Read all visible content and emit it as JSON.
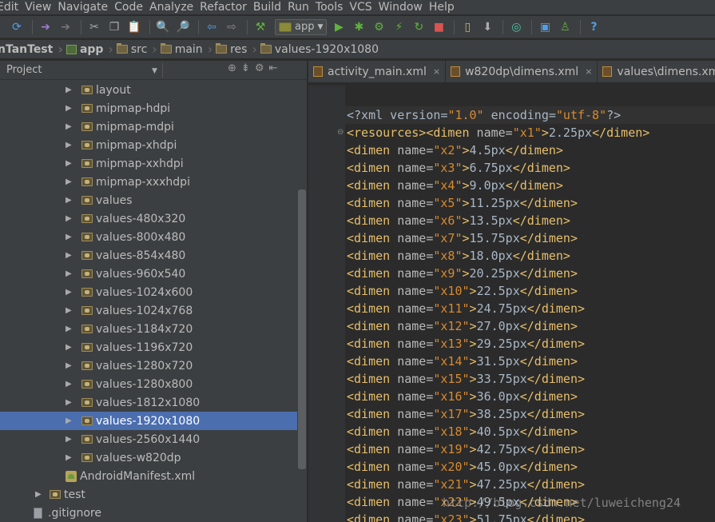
{
  "menu": [
    "Edit",
    "View",
    "Navigate",
    "Code",
    "Analyze",
    "Refactor",
    "Build",
    "Run",
    "Tools",
    "VCS",
    "Window",
    "Help"
  ],
  "toolbar": {
    "run_config": "app",
    "icons": [
      "sync-icon",
      "undo-icon",
      "redo-icon",
      "cut-icon",
      "copy-icon",
      "paste-icon",
      "find-icon",
      "replace-icon",
      "back-icon",
      "forward-icon",
      "make-icon",
      "run-icon",
      "debug-icon",
      "attach-icon",
      "apply-changes-icon",
      "rerun-icon",
      "stop-icon",
      "avd-manager-icon",
      "sdk-manager-icon",
      "project-structure-icon",
      "sync-gradle-icon",
      "help-icon"
    ]
  },
  "breadcrumb": [
    "nTanTest",
    "app",
    "src",
    "main",
    "res",
    "values-1920x1080"
  ],
  "project_panel": {
    "title": "Project",
    "items": [
      {
        "label": "layout",
        "type": "folder",
        "depth": 0,
        "expandable": true
      },
      {
        "label": "mipmap-hdpi",
        "type": "folder",
        "depth": 0,
        "expandable": true
      },
      {
        "label": "mipmap-mdpi",
        "type": "folder",
        "depth": 0,
        "expandable": true
      },
      {
        "label": "mipmap-xhdpi",
        "type": "folder",
        "depth": 0,
        "expandable": true
      },
      {
        "label": "mipmap-xxhdpi",
        "type": "folder",
        "depth": 0,
        "expandable": true
      },
      {
        "label": "mipmap-xxxhdpi",
        "type": "folder",
        "depth": 0,
        "expandable": true
      },
      {
        "label": "values",
        "type": "folder",
        "depth": 0,
        "expandable": true
      },
      {
        "label": "values-480x320",
        "type": "folder",
        "depth": 0,
        "expandable": true
      },
      {
        "label": "values-800x480",
        "type": "folder",
        "depth": 0,
        "expandable": true
      },
      {
        "label": "values-854x480",
        "type": "folder",
        "depth": 0,
        "expandable": true
      },
      {
        "label": "values-960x540",
        "type": "folder",
        "depth": 0,
        "expandable": true
      },
      {
        "label": "values-1024x600",
        "type": "folder",
        "depth": 0,
        "expandable": true
      },
      {
        "label": "values-1024x768",
        "type": "folder",
        "depth": 0,
        "expandable": true
      },
      {
        "label": "values-1184x720",
        "type": "folder",
        "depth": 0,
        "expandable": true
      },
      {
        "label": "values-1196x720",
        "type": "folder",
        "depth": 0,
        "expandable": true
      },
      {
        "label": "values-1280x720",
        "type": "folder",
        "depth": 0,
        "expandable": true
      },
      {
        "label": "values-1280x800",
        "type": "folder",
        "depth": 0,
        "expandable": true
      },
      {
        "label": "values-1812x1080",
        "type": "folder",
        "depth": 0,
        "expandable": true
      },
      {
        "label": "values-1920x1080",
        "type": "folder",
        "depth": 0,
        "expandable": true,
        "selected": true
      },
      {
        "label": "values-2560x1440",
        "type": "folder",
        "depth": 0,
        "expandable": true
      },
      {
        "label": "values-w820dp",
        "type": "folder",
        "depth": 0,
        "expandable": true
      },
      {
        "label": "AndroidManifest.xml",
        "type": "manifest",
        "depth": 1,
        "expandable": false
      },
      {
        "label": "test",
        "type": "folder",
        "depth": 2,
        "expandable": true
      },
      {
        "label": ".gitignore",
        "type": "file",
        "depth": 3,
        "expandable": false
      }
    ]
  },
  "tabs": [
    {
      "label": "activity_main.xml",
      "active": false
    },
    {
      "label": "w820dp\\dimens.xml",
      "active": false
    },
    {
      "label": "values\\dimens.xml",
      "active": false
    }
  ],
  "code": {
    "declaration": {
      "version": "1.0",
      "encoding": "utf-8"
    },
    "root_tag": "resources",
    "dimens": [
      {
        "name": "x1",
        "value": "2.25px"
      },
      {
        "name": "x2",
        "value": "4.5px"
      },
      {
        "name": "x3",
        "value": "6.75px"
      },
      {
        "name": "x4",
        "value": "9.0px"
      },
      {
        "name": "x5",
        "value": "11.25px"
      },
      {
        "name": "x6",
        "value": "13.5px"
      },
      {
        "name": "x7",
        "value": "15.75px"
      },
      {
        "name": "x8",
        "value": "18.0px"
      },
      {
        "name": "x9",
        "value": "20.25px"
      },
      {
        "name": "x10",
        "value": "22.5px"
      },
      {
        "name": "x11",
        "value": "24.75px"
      },
      {
        "name": "x12",
        "value": "27.0px"
      },
      {
        "name": "x13",
        "value": "29.25px"
      },
      {
        "name": "x14",
        "value": "31.5px"
      },
      {
        "name": "x15",
        "value": "33.75px"
      },
      {
        "name": "x16",
        "value": "36.0px"
      },
      {
        "name": "x17",
        "value": "38.25px"
      },
      {
        "name": "x18",
        "value": "40.5px"
      },
      {
        "name": "x19",
        "value": "42.75px"
      },
      {
        "name": "x20",
        "value": "45.0px"
      },
      {
        "name": "x21",
        "value": "47.25px"
      },
      {
        "name": "x22",
        "value": "49.5px"
      },
      {
        "name": "x23",
        "value": "51.75px"
      }
    ]
  },
  "watermark": "http://blog.csdn.net/luweicheng24",
  "colors": {
    "selection": "#4b6eaf",
    "tag": "#e8bf6a",
    "string": "#d88a2f",
    "text": "#a9b7c6",
    "background": "#2b2b2b",
    "panel": "#3c3f41"
  }
}
